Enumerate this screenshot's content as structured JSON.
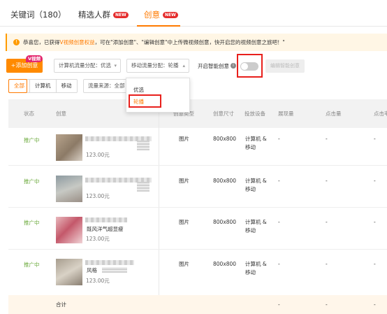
{
  "tabs": [
    {
      "label": "关键词（180）"
    },
    {
      "label": "精选人群",
      "badge": "NEW"
    },
    {
      "label": "创意",
      "badge": "NEW",
      "active": true
    }
  ],
  "notice": {
    "pre": "恭喜您，已获得",
    "highlight": "V视频创意权益",
    "post": "，可在\"添加创意\"、\"编辑创意\"中上传微视频创意，快开启您的视频创意之旅吧！\""
  },
  "toolbar": {
    "add_label": "+添加创意",
    "video_badge": "V视频",
    "pc_allocation": "计算机流量分配：优选",
    "mobile_allocation": "移动流量分配：轮播",
    "smart_creative_label": "开启智能创意",
    "smart_creative_on": false,
    "edit_smart_label": "编辑智能创意"
  },
  "filters": {
    "device_segments": [
      "全部",
      "计算机",
      "移动"
    ],
    "active_segment": "全部",
    "traffic_source": "流量来源：全部"
  },
  "dropdown": {
    "options": [
      "优选",
      "轮播"
    ],
    "selected": "轮播"
  },
  "table": {
    "columns": [
      "状态",
      "创意",
      "创意类型",
      "创意尺寸",
      "投放设备",
      "展现量",
      "点击量",
      "点击率"
    ],
    "rows": [
      {
        "status": "推广中",
        "title_fragment": "",
        "price": "123.00元",
        "type": "图片",
        "size": "800x800",
        "device_line1": "计算机 &",
        "device_line2": "移动",
        "impressions": "-",
        "clicks": "-",
        "ctr": "-"
      },
      {
        "status": "推广中",
        "title_fragment": "",
        "price": "123.00元",
        "type": "图片",
        "size": "800x800",
        "device_line1": "计算机 &",
        "device_line2": "移动",
        "impressions": "-",
        "clicks": "-",
        "ctr": "-"
      },
      {
        "status": "推广中",
        "title_fragment": "既风洋气超显瘦",
        "price": "123.00元",
        "type": "图片",
        "size": "800x800",
        "device_line1": "计算机 &",
        "device_line2": "移动",
        "impressions": "-",
        "clicks": "-",
        "ctr": "-"
      },
      {
        "status": "推广中",
        "title_fragment": "风格",
        "price": "123.00元",
        "type": "图片",
        "size": "800x800",
        "device_line1": "计算机 &",
        "device_line2": "移动",
        "impressions": "-",
        "clicks": "-",
        "ctr": "-"
      }
    ],
    "summary": {
      "label": "合计",
      "impressions": "-",
      "clicks": "-",
      "ctr": "-"
    }
  },
  "colors": {
    "accent": "#ff7a00",
    "badge_red": "#e52d2d",
    "status_green": "#6aa93a",
    "highlight_box": "#e8201c"
  }
}
